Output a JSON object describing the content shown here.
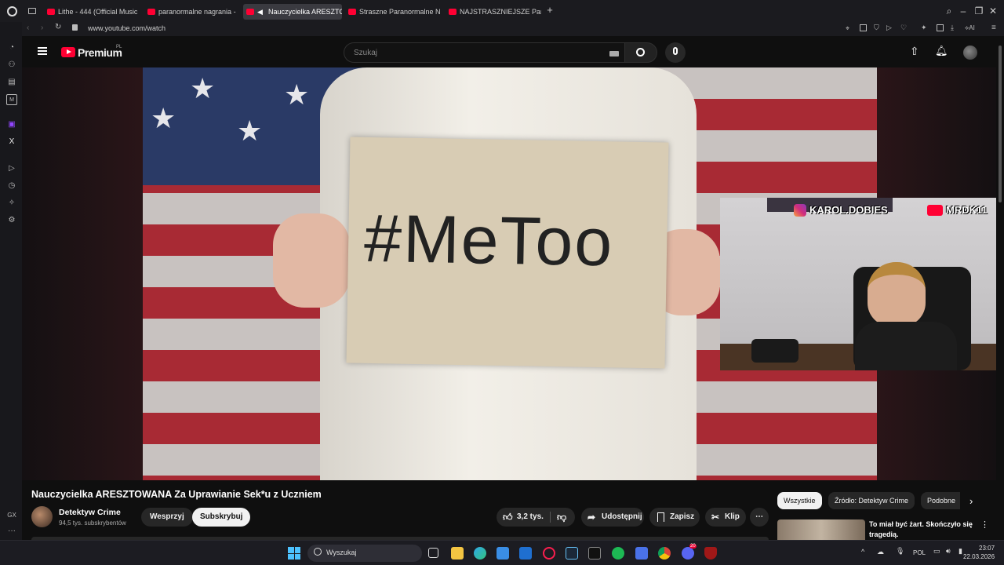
{
  "browser": {
    "tabs": [
      {
        "label": "Lithe - 444 (Official Music",
        "active": false
      },
      {
        "label": "paranormalne nagrania -",
        "active": false
      },
      {
        "label": "Nauczycielka ARESZTO",
        "active": true
      },
      {
        "label": "Straszne Paranormalne N",
        "active": false
      },
      {
        "label": "NAJSTRASZNIEJSZE Para",
        "active": false
      }
    ],
    "new_tab": "+",
    "url": "www.youtube.com/watch",
    "ai_label": "AI",
    "sidebar_gx": "GX"
  },
  "youtube": {
    "logo": "Premium",
    "logo_region": "PL",
    "search_placeholder": "Szukaj",
    "video_sign_text": "#MeToo",
    "overlay": {
      "instagram": "KAROL.DOBIES",
      "youtube": "MRDK11"
    },
    "title": "Nauczycielka ARESZTOWANA Za Uprawianie Sek*u z Uczniem",
    "channel": {
      "name": "Detektyw Crime",
      "subs": "94,5 tys. subskrybentów"
    },
    "support_label": "Wesprzyj",
    "subscribe_label": "Subskrybuj",
    "like_count": "3,2 tys.",
    "share_label": "Udostępnij",
    "save_label": "Zapisz",
    "clip_label": "Klip",
    "chips": [
      "Wszystkie",
      "Źródło: Detektyw Crime",
      "Podobne"
    ],
    "recommended": {
      "title": "To miał być żart. Skończyło się tragedią."
    }
  },
  "taskbar": {
    "search_label": "Wyszukaj",
    "lang": "POL",
    "time": "23:07",
    "date": "22.03.2026",
    "discord_badge": "20"
  }
}
